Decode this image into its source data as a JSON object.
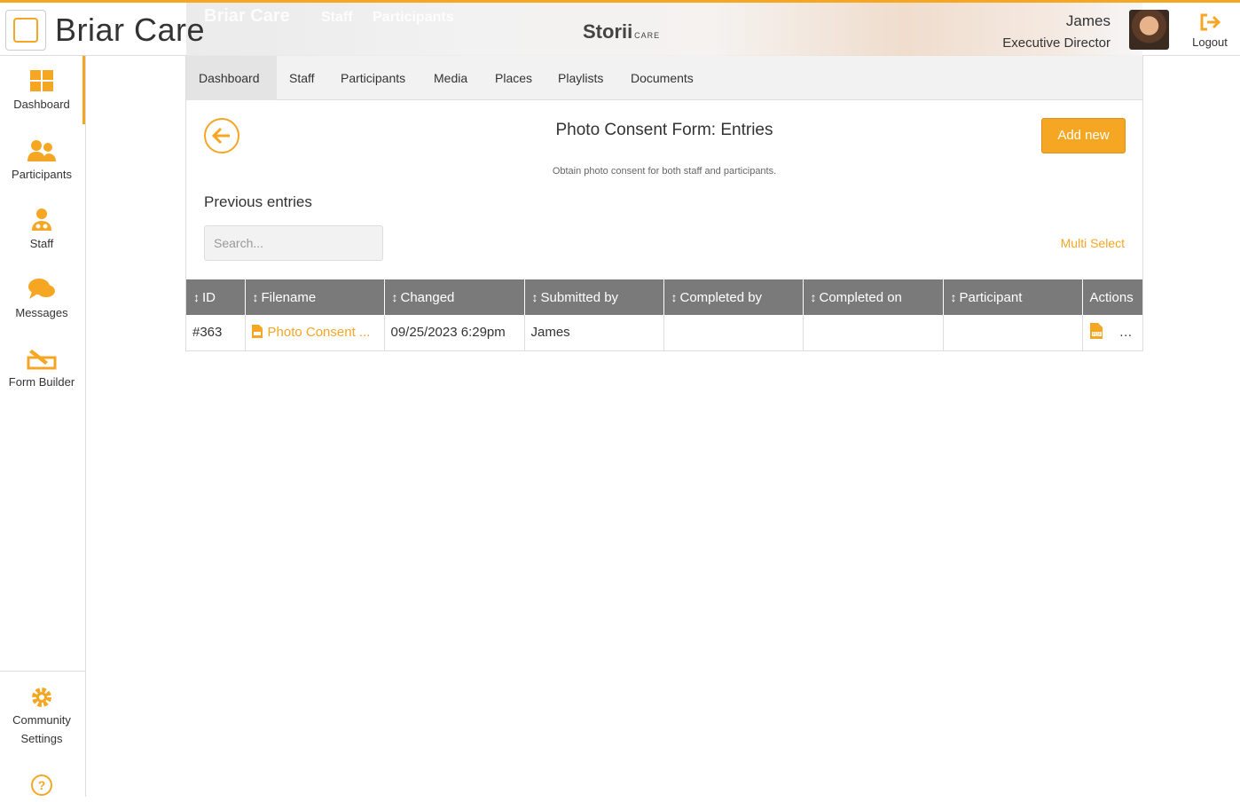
{
  "header": {
    "brand": "Briar Care",
    "banner_ghost_title": "Briar Care",
    "banner_ghost_links": [
      "Staff",
      "Participants"
    ],
    "product": "Storii",
    "product_suffix": "CARE",
    "user_name": "James",
    "user_role": "Executive Director",
    "logout_label": "Logout",
    "accent_color": "#f5a623"
  },
  "sidebar": {
    "items": [
      {
        "label": "Dashboard",
        "icon": "dashboard-grid-icon"
      },
      {
        "label": "Participants",
        "icon": "participants-icon"
      },
      {
        "label": "Staff",
        "icon": "staff-icon"
      },
      {
        "label": "Messages",
        "icon": "messages-icon"
      },
      {
        "label": "Form Builder",
        "icon": "form-builder-icon"
      }
    ],
    "bottom": {
      "settings_label_1": "Community",
      "settings_label_2": "Settings",
      "settings_icon": "gear-icon",
      "help_icon": "help-icon"
    }
  },
  "tabs": [
    "Dashboard",
    "Staff",
    "Participants",
    "Media",
    "Places",
    "Playlists",
    "Documents"
  ],
  "page": {
    "title": "Photo Consent Form: Entries",
    "subtitle": "Obtain photo consent for both staff and participants.",
    "add_button": "Add new",
    "previous_entries": "Previous entries",
    "search_placeholder": "Search...",
    "multi_select": "Multi Select"
  },
  "table": {
    "columns": [
      "ID",
      "Filename",
      "Changed",
      "Submitted by",
      "Completed by",
      "Completed on",
      "Participant",
      "Actions"
    ],
    "rows": [
      {
        "id": "#363",
        "filename": "Photo Consent ...",
        "changed": "09/25/2023 6:29pm",
        "submitted_by": "James",
        "completed_by": "",
        "completed_on": "",
        "participant": ""
      }
    ]
  }
}
